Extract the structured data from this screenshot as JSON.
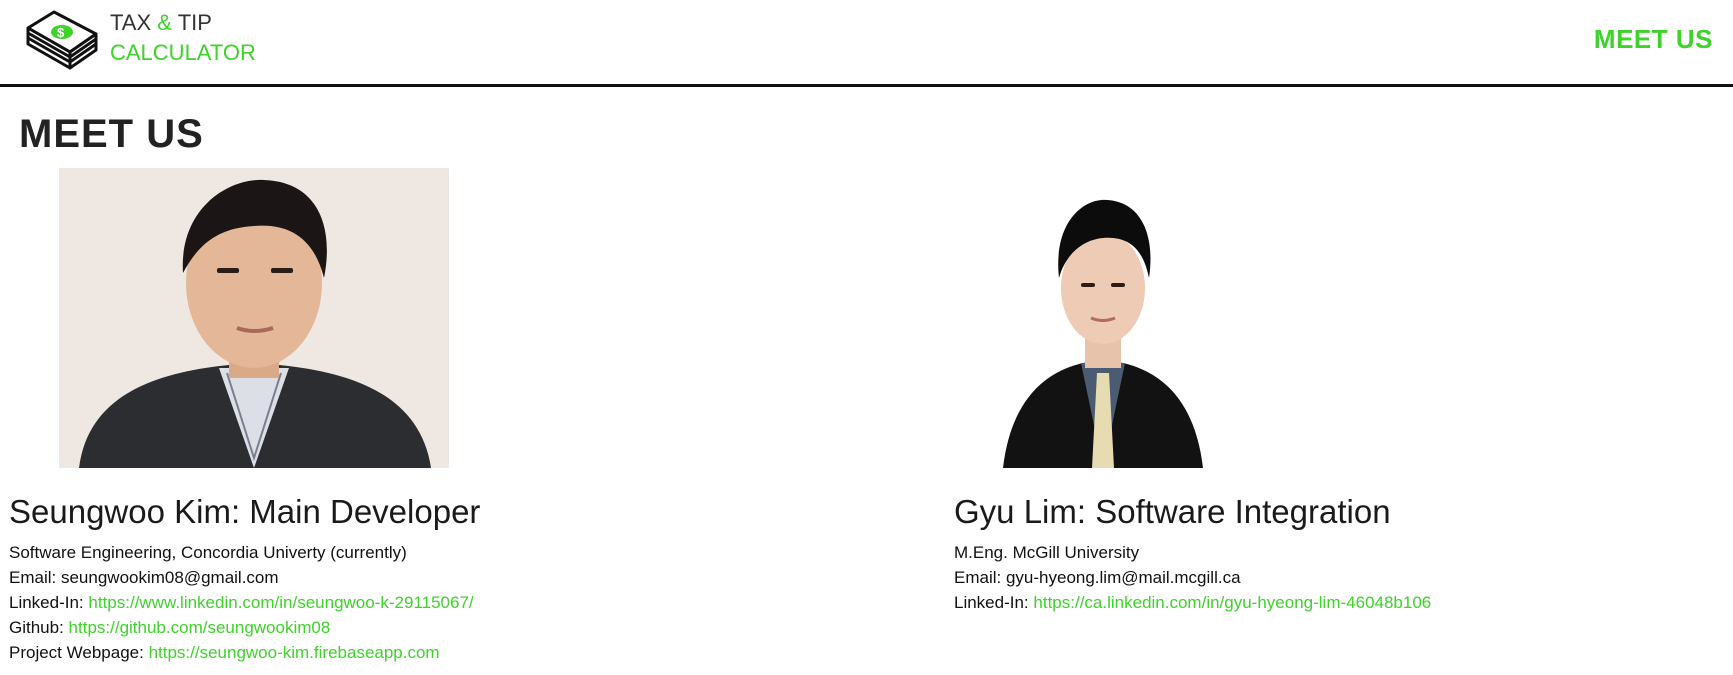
{
  "header": {
    "brand_line1": "TAX",
    "brand_amp": "&",
    "brand_line1_end": "TIP",
    "brand_line2": "CALCULATOR",
    "logo_icon": "money-stack-icon",
    "nav_meet_us": "MEET US"
  },
  "colors": {
    "accent": "#3ed22a",
    "text": "#111111",
    "border": "#111111"
  },
  "page": {
    "title": "MEET US"
  },
  "members": [
    {
      "name": "Seungwoo Kim: Main Developer",
      "education": "Software Engineering, Concordia Univerty (currently)",
      "email_label": "Email:",
      "email": "seungwookim08@gmail.com",
      "linkedin_label": "Linked-In:",
      "linkedin": "https://www.linkedin.com/in/seungwoo-k-29115067/",
      "github_label": "Github:",
      "github": "https://github.com/seungwookim08",
      "webpage_label": "Project Webpage:",
      "webpage": "https://seungwoo-kim.firebaseapp.com"
    },
    {
      "name": "Gyu Lim: Software Integration",
      "education": "M.Eng. McGill University",
      "email_label": "Email:",
      "email": "gyu-hyeong.lim@mail.mcgill.ca",
      "linkedin_label": "Linked-In:",
      "linkedin": "https://ca.linkedin.com/in/gyu-hyeong-lim-46048b106"
    }
  ]
}
